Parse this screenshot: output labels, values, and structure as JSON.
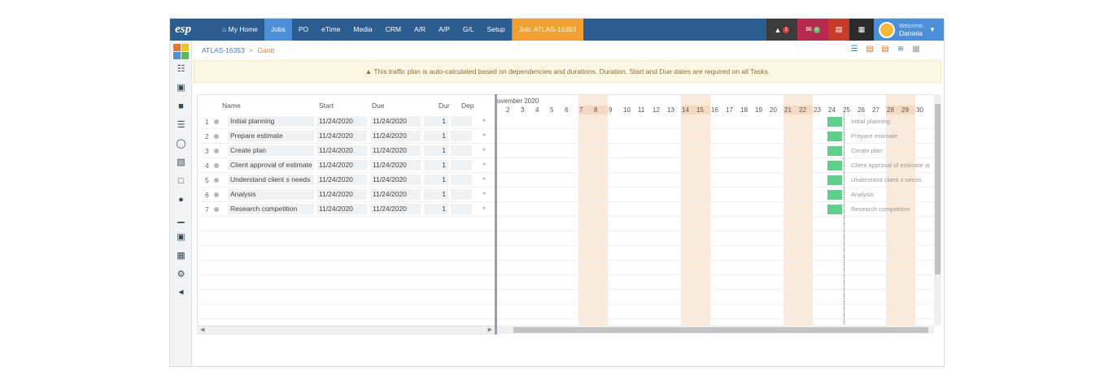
{
  "topbar": {
    "logo": "esp",
    "nav": [
      "My Home",
      "Jobs",
      "PO",
      "eTime",
      "Media",
      "CRM",
      "A/R",
      "A/P",
      "G/L",
      "Setup"
    ],
    "job_tab": "Job: ATLAS-16353",
    "bell_count": "1",
    "mail_count": "0",
    "welcome": "Welcome,",
    "user": "Daniela"
  },
  "breadcrumb": {
    "parent": "ATLAS-16353",
    "sep": ">",
    "current": "Gantt"
  },
  "banner": "This traffic plan is auto-calculated based on dependencies and durations. Duration, Start and Due dates are required on all Tasks.",
  "grid": {
    "headers": {
      "name": "Name",
      "start": "Start",
      "due": "Due",
      "dur": "Dur",
      "dep": "Dep"
    },
    "tasks": [
      {
        "num": "1",
        "name": "Initial planning",
        "start": "11/24/2020",
        "due": "11/24/2020",
        "dur": "1"
      },
      {
        "num": "2",
        "name": "Prepare estimate",
        "start": "11/24/2020",
        "due": "11/24/2020",
        "dur": "1"
      },
      {
        "num": "3",
        "name": "Create plan",
        "start": "11/24/2020",
        "due": "11/24/2020",
        "dur": "1"
      },
      {
        "num": "4",
        "name": "Client approval of estimate ar",
        "start": "11/24/2020",
        "due": "11/24/2020",
        "dur": "1"
      },
      {
        "num": "5",
        "name": "Understand client s needs",
        "start": "11/24/2020",
        "due": "11/24/2020",
        "dur": "1"
      },
      {
        "num": "6",
        "name": "Analysis",
        "start": "11/24/2020",
        "due": "11/24/2020",
        "dur": "1"
      },
      {
        "num": "7",
        "name": "Research competition",
        "start": "11/24/2020",
        "due": "11/24/2020",
        "dur": "1"
      }
    ]
  },
  "chart": {
    "month": "ovember 2020",
    "days": [
      "2",
      "3",
      "4",
      "5",
      "6",
      "7",
      "8",
      "9",
      "10",
      "11",
      "12",
      "13",
      "14",
      "15",
      "16",
      "17",
      "18",
      "19",
      "20",
      "21",
      "22",
      "23",
      "24",
      "25",
      "26",
      "27",
      "28",
      "29",
      "30"
    ],
    "weekend_days": [
      "7",
      "8",
      "14",
      "15",
      "21",
      "22",
      "28",
      "29"
    ],
    "bar_labels": [
      "Initial planning",
      "Prepare estimate",
      "Create plan",
      "Client approval of estimate ar",
      "Understand client s needs",
      "Analysis",
      "Research competition"
    ]
  }
}
